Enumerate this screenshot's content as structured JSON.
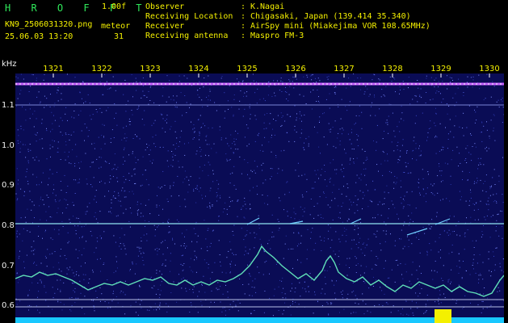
{
  "header": {
    "app_title": "H R O F F T",
    "version": "1.00f",
    "filename": "KN9_2506031320.png",
    "meteor_label": "meteor",
    "datetime": "25.06.03 13:20",
    "meteor_count": "31",
    "fields": [
      {
        "label": "Observer",
        "value": "K.Nagai"
      },
      {
        "label": "Receiving Location",
        "value": "Chigasaki, Japan (139.414 35.340)"
      },
      {
        "label": "Receiver",
        "value": "AirSpy mini (Miakejima VOR 108.65MHz)"
      },
      {
        "label": "Receiving antenna",
        "value": "Maspro FM-3"
      }
    ]
  },
  "y_axis": {
    "unit": "kHz",
    "ticks": [
      "1.1",
      "1.0",
      "0.9",
      "0.8",
      "0.7",
      "0.6"
    ]
  },
  "x_axis": {
    "ticks": [
      "1321",
      "1322",
      "1323",
      "1324",
      "1325",
      "1326",
      "1327",
      "1328",
      "1329",
      "1330"
    ]
  },
  "colors": {
    "background": "#000000",
    "plot_bg": "#0a0c55",
    "header_text": "#f4f000",
    "title_text": "#2fe85a",
    "trace": "#60e0b8",
    "carrier": "#c860ff",
    "axis_label": "#f0f0f0"
  }
}
